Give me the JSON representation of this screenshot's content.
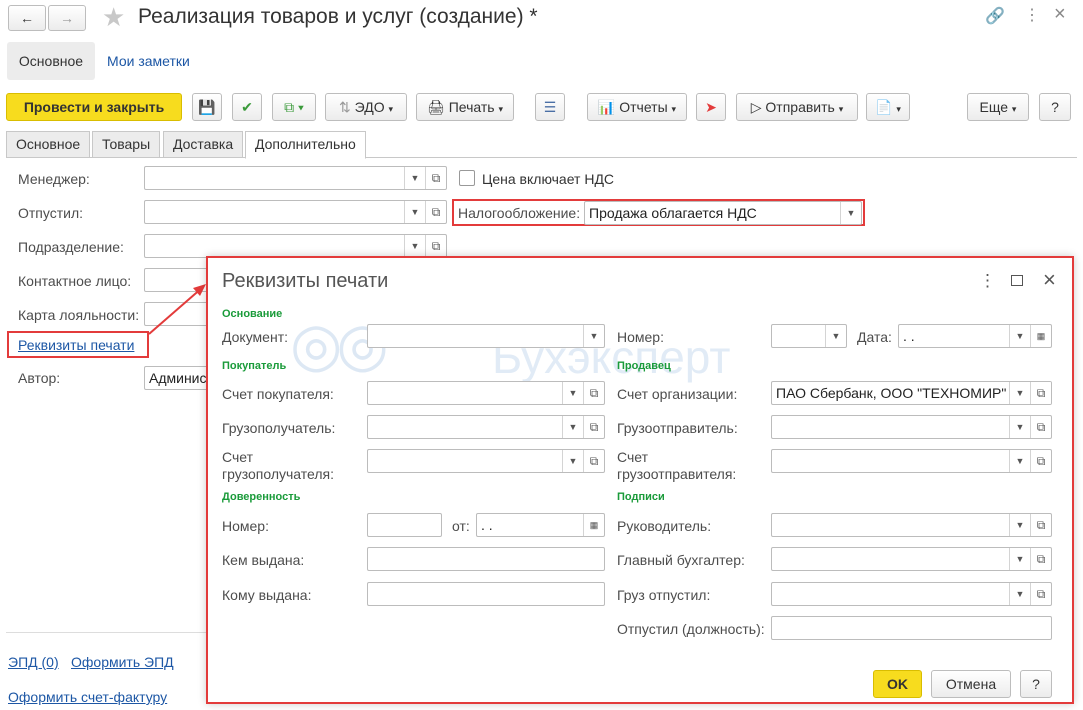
{
  "window": {
    "title": "Реализация товаров и услуг (создание) *"
  },
  "nav_tabs": [
    "Основное",
    "Мои заметки"
  ],
  "toolbar": {
    "post_close": "Провести и закрыть",
    "edo": "ЭДО",
    "print": "Печать",
    "reports": "Отчеты",
    "send": "Отправить",
    "more": "Еще",
    "help": "?"
  },
  "tabs": [
    "Основное",
    "Товары",
    "Доставка",
    "Дополнительно"
  ],
  "form": {
    "manager": "Менеджер:",
    "released": "Отпустил:",
    "department": "Подразделение:",
    "contact": "Контактное лицо:",
    "loyalty": "Карта лояльности:",
    "print_details_link": "Реквизиты печати",
    "author": "Автор:",
    "author_value": "Админис",
    "price_includes_vat": "Цена включает НДС",
    "taxation": "Налогообложение:",
    "taxation_value": "Продажа облагается НДС",
    "epd": "ЭПД (0)",
    "make_epd": "Оформить ЭПД",
    "make_invoice": "Оформить счет-фактуру"
  },
  "dialog": {
    "title": "Реквизиты печати",
    "watermark": "Бухэксперт",
    "sections": {
      "basis": "Основание",
      "buyer": "Покупатель",
      "seller": "Продавец",
      "proxy": "Доверенность",
      "signatures": "Подписи"
    },
    "document": "Документ:",
    "number": "Номер:",
    "date": "Дата:",
    "date_value": " .  .",
    "buyer_account": "Счет покупателя:",
    "consignee": "Грузополучатель:",
    "consignee_account_1": "Счет",
    "consignee_account_2": "грузополучателя:",
    "org_account": "Счет организации:",
    "org_account_value": "ПАО Сбербанк, ООО \"ТЕХНОМИР\"",
    "consignor": "Грузоотправитель:",
    "consignor_account_1": "Счет",
    "consignor_account_2": "грузоотправителя:",
    "proxy_number": "Номер:",
    "proxy_from": "от:",
    "proxy_date_value": " .  .",
    "issued_by": "Кем выдана:",
    "issued_to": "Кому выдана:",
    "director": "Руководитель:",
    "chief_accountant": "Главный бухгалтер:",
    "cargo_released": "Груз отпустил:",
    "released_position": "Отпустил (должность):",
    "ok": "OK",
    "cancel": "Отмена",
    "help": "?"
  }
}
